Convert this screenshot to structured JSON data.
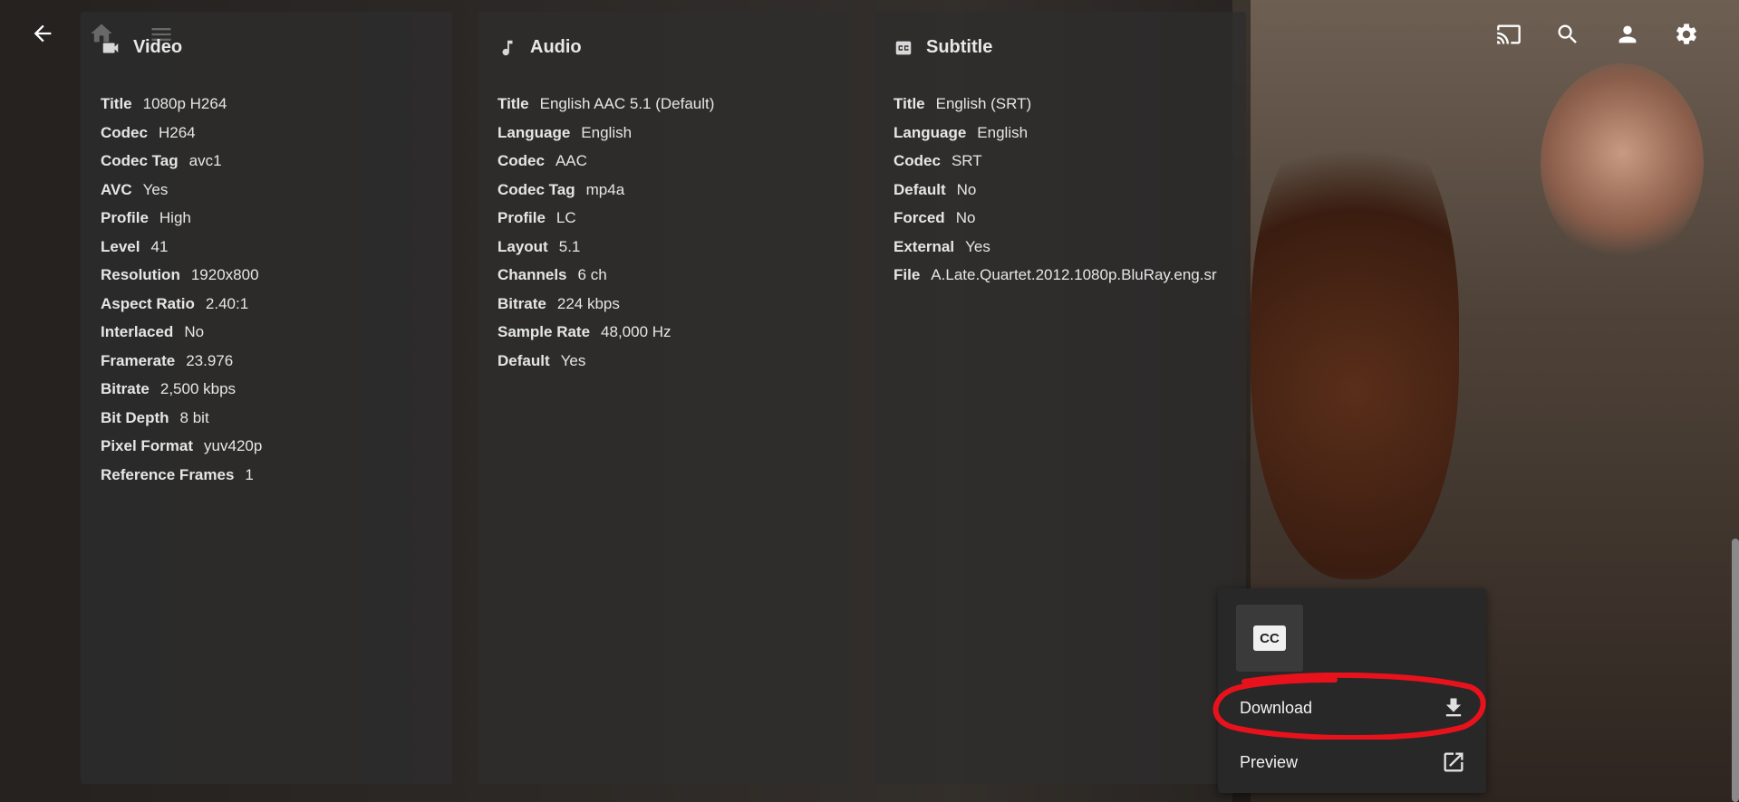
{
  "topbar": {
    "back_icon": "back-arrow-icon",
    "home_icon": "home-icon",
    "menu_icon": "hamburger-menu-icon",
    "cast_icon": "cast-icon",
    "search_icon": "search-icon",
    "user_icon": "user-icon",
    "settings_icon": "gear-icon"
  },
  "panels": {
    "video": {
      "title": "Video",
      "icon": "videocam-icon",
      "rows": [
        {
          "k": "Title",
          "v": "1080p H264"
        },
        {
          "k": "Codec",
          "v": "H264"
        },
        {
          "k": "Codec Tag",
          "v": "avc1"
        },
        {
          "k": "AVC",
          "v": "Yes"
        },
        {
          "k": "Profile",
          "v": "High"
        },
        {
          "k": "Level",
          "v": "41"
        },
        {
          "k": "Resolution",
          "v": "1920x800"
        },
        {
          "k": "Aspect Ratio",
          "v": "2.40:1"
        },
        {
          "k": "Interlaced",
          "v": "No"
        },
        {
          "k": "Framerate",
          "v": "23.976"
        },
        {
          "k": "Bitrate",
          "v": "2,500 kbps"
        },
        {
          "k": "Bit Depth",
          "v": "8 bit"
        },
        {
          "k": "Pixel Format",
          "v": "yuv420p"
        },
        {
          "k": "Reference Frames",
          "v": "1"
        }
      ]
    },
    "audio": {
      "title": "Audio",
      "icon": "music-note-icon",
      "rows": [
        {
          "k": "Title",
          "v": "English AAC 5.1 (Default)"
        },
        {
          "k": "Language",
          "v": "English"
        },
        {
          "k": "Codec",
          "v": "AAC"
        },
        {
          "k": "Codec Tag",
          "v": "mp4a"
        },
        {
          "k": "Profile",
          "v": "LC"
        },
        {
          "k": "Layout",
          "v": "5.1"
        },
        {
          "k": "Channels",
          "v": "6 ch"
        },
        {
          "k": "Bitrate",
          "v": "224 kbps"
        },
        {
          "k": "Sample Rate",
          "v": "48,000 Hz"
        },
        {
          "k": "Default",
          "v": "Yes"
        }
      ]
    },
    "subtitle": {
      "title": "Subtitle",
      "icon": "closed-caption-icon",
      "rows": [
        {
          "k": "Title",
          "v": "English (SRT)"
        },
        {
          "k": "Language",
          "v": "English"
        },
        {
          "k": "Codec",
          "v": "SRT"
        },
        {
          "k": "Default",
          "v": "No"
        },
        {
          "k": "Forced",
          "v": "No"
        },
        {
          "k": "External",
          "v": "Yes"
        },
        {
          "k": "File",
          "v": "A.Late.Quartet.2012.1080p.BluRay.eng.sr"
        }
      ]
    }
  },
  "menu": {
    "cc_label": "CC",
    "items": [
      {
        "label": "Download",
        "icon": "download-icon"
      },
      {
        "label": "Preview",
        "icon": "open-external-icon"
      }
    ]
  },
  "annotation_color": "#e8121c"
}
